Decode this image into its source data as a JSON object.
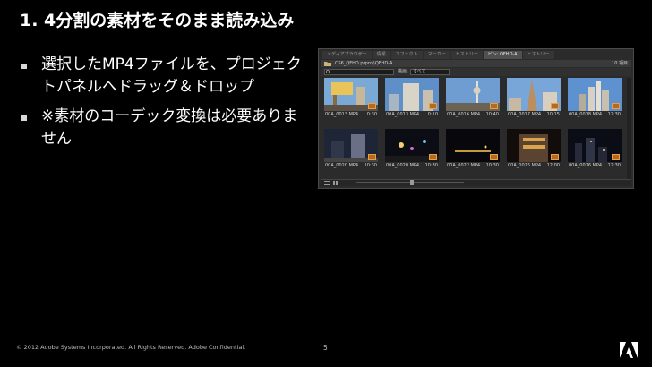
{
  "slide": {
    "title": "1. 4分割の素材をそのまま読み込み",
    "bullets": [
      "選択したMP4ファイルを、プロジェクトパネルへドラッグ＆ドロップ",
      "※素材のコーデック変換は必要ありません"
    ],
    "footer": "© 2012 Adobe Systems Incorporated.  All Rights Reserved.  Adobe Confidential.",
    "page_number": "5",
    "logo": "Adobe"
  },
  "panel": {
    "tabs": [
      {
        "label": "メディアブラウザー",
        "active": false
      },
      {
        "label": "情報",
        "active": false
      },
      {
        "label": "エフェクト",
        "active": false
      },
      {
        "label": "マーカー",
        "active": false
      },
      {
        "label": "ヒストリー",
        "active": false
      },
      {
        "label": "ビン: QFHD-A",
        "active": true
      },
      {
        "label": "ヒストリー",
        "active": false
      }
    ],
    "path": "CS6_QFHD.prproj\\QFHD-A",
    "count": "10 項目",
    "filter_label": "描画:",
    "filter_value": "すべて",
    "clips": [
      {
        "name": "00A_0013.MP4",
        "duration": "0:30",
        "scene": "sign"
      },
      {
        "name": "00A_0013.MP4",
        "duration": "0:10",
        "scene": "tower-hotel"
      },
      {
        "name": "00A_0016.MP4",
        "duration": "10:40",
        "scene": "sky-tower"
      },
      {
        "name": "00A_0017.MP4",
        "duration": "10:15",
        "scene": "paris-hotel"
      },
      {
        "name": "00A_0018.MP4",
        "duration": "12:30",
        "scene": "newyork"
      },
      {
        "name": "00A_0020.MP4",
        "duration": "10:30",
        "scene": "night-buildings"
      },
      {
        "name": "00A_0020.MP4",
        "duration": "10:30",
        "scene": "night-lights"
      },
      {
        "name": "00A_0022.MP4",
        "duration": "10:30",
        "scene": "night-dark"
      },
      {
        "name": "00A_0026.MP4",
        "duration": "12:00",
        "scene": "night-casino"
      },
      {
        "name": "00A_0026.MP4",
        "duration": "12:30",
        "scene": "night-skyline"
      }
    ],
    "icons": [
      "search-icon",
      "list-view-icon",
      "icon-view-icon",
      "zoom-slider",
      "clip-badge-icon"
    ]
  }
}
